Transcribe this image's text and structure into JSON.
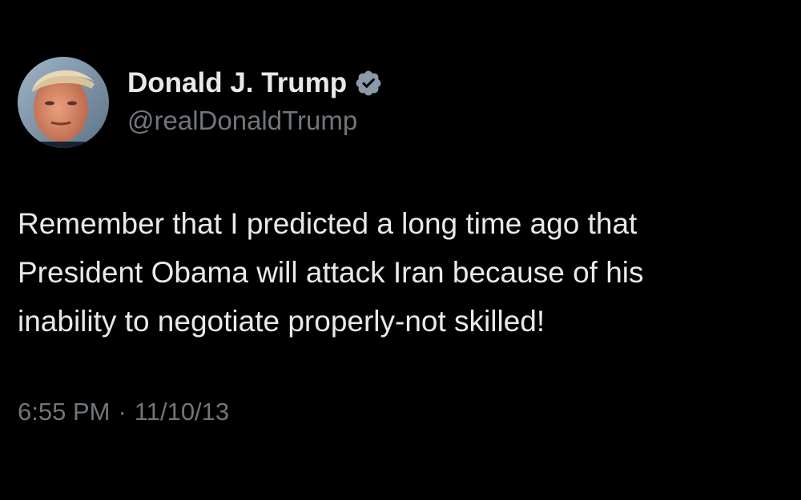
{
  "tweet": {
    "author": {
      "display_name": "Donald J. Trump",
      "handle": "@realDonaldTrump",
      "verified": true,
      "verified_badge_color": "#1d9bf0",
      "avatar_icon": "profile-photo"
    },
    "text": "Remember that I predicted a long time ago that\nPresident Obama will attack Iran because of his\ninability to negotiate properly-not skilled!",
    "time": "6:55 PM",
    "separator": "·",
    "date": "11/10/13"
  },
  "colors": {
    "background": "#000000",
    "primary_text": "#e7e9ea",
    "secondary_text": "#71767b"
  }
}
